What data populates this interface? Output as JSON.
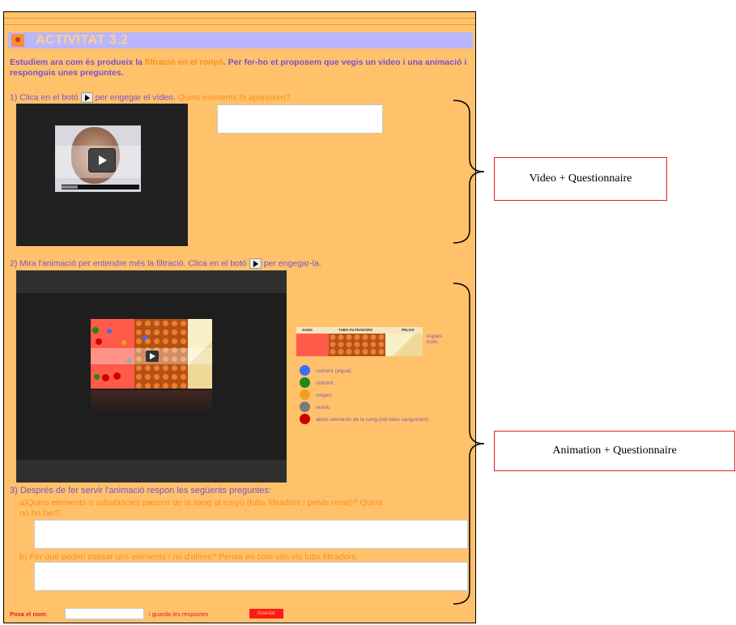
{
  "activity": {
    "title": "ACTIVITAT 3.2",
    "intro_part1": "Estudiem ara com és produeix la ",
    "intro_highlight": "filtració en el ronyó",
    "intro_part2": ". Per fer-ho et proposem que vegis un video i una animació i responguis unes preguntes."
  },
  "q1": {
    "prefix": "1) Clica en el botó",
    "middle": "per engegar el vídeo.",
    "question": " Quins elements hi apareixen?",
    "answer_value": ""
  },
  "q2": {
    "prefix": "2) Mira l'animació per entendre més la filtració. Clica en el botó",
    "suffix": "per engegar-la."
  },
  "legend": {
    "header_sang": "SANG",
    "header_tubs": "TUBS FILTRADORS",
    "header_pelvis": "PELVIS",
    "side_label": "espais buits",
    "items": [
      {
        "color": "#3b6bff",
        "label": "nutrient (aigua)"
      },
      {
        "color": "#1a8a1a",
        "label": "nutrient"
      },
      {
        "color": "#f0a020",
        "label": "oxigen"
      },
      {
        "color": "#7a7a7a",
        "label": "residu"
      },
      {
        "color": "#cc0000",
        "label": "altres elements de la sang (cèl·lules sanguínies)"
      }
    ]
  },
  "q3": {
    "heading": "3) Després de fer servir l'animació respon les següents preguntes:",
    "a_line1": "a)Quins elements o substàncies passen de la sang al ronyó (tubs filtradors i pelvis renal)? Quins",
    "a_line2": "no ho fan?",
    "a_value": "",
    "b_text": "b) Per què poden passar uns elements i no d'altres? Pensa en com són els tubs filtradors.",
    "b_value": ""
  },
  "footer": {
    "name_label": "Posa el nom:",
    "name_value": "",
    "save_text": "i guarda les respostes",
    "save_button": "Guardar"
  },
  "annotations": {
    "video_box": "Video + Questionnaire",
    "animation_box": "Animation + Questionnaire"
  }
}
